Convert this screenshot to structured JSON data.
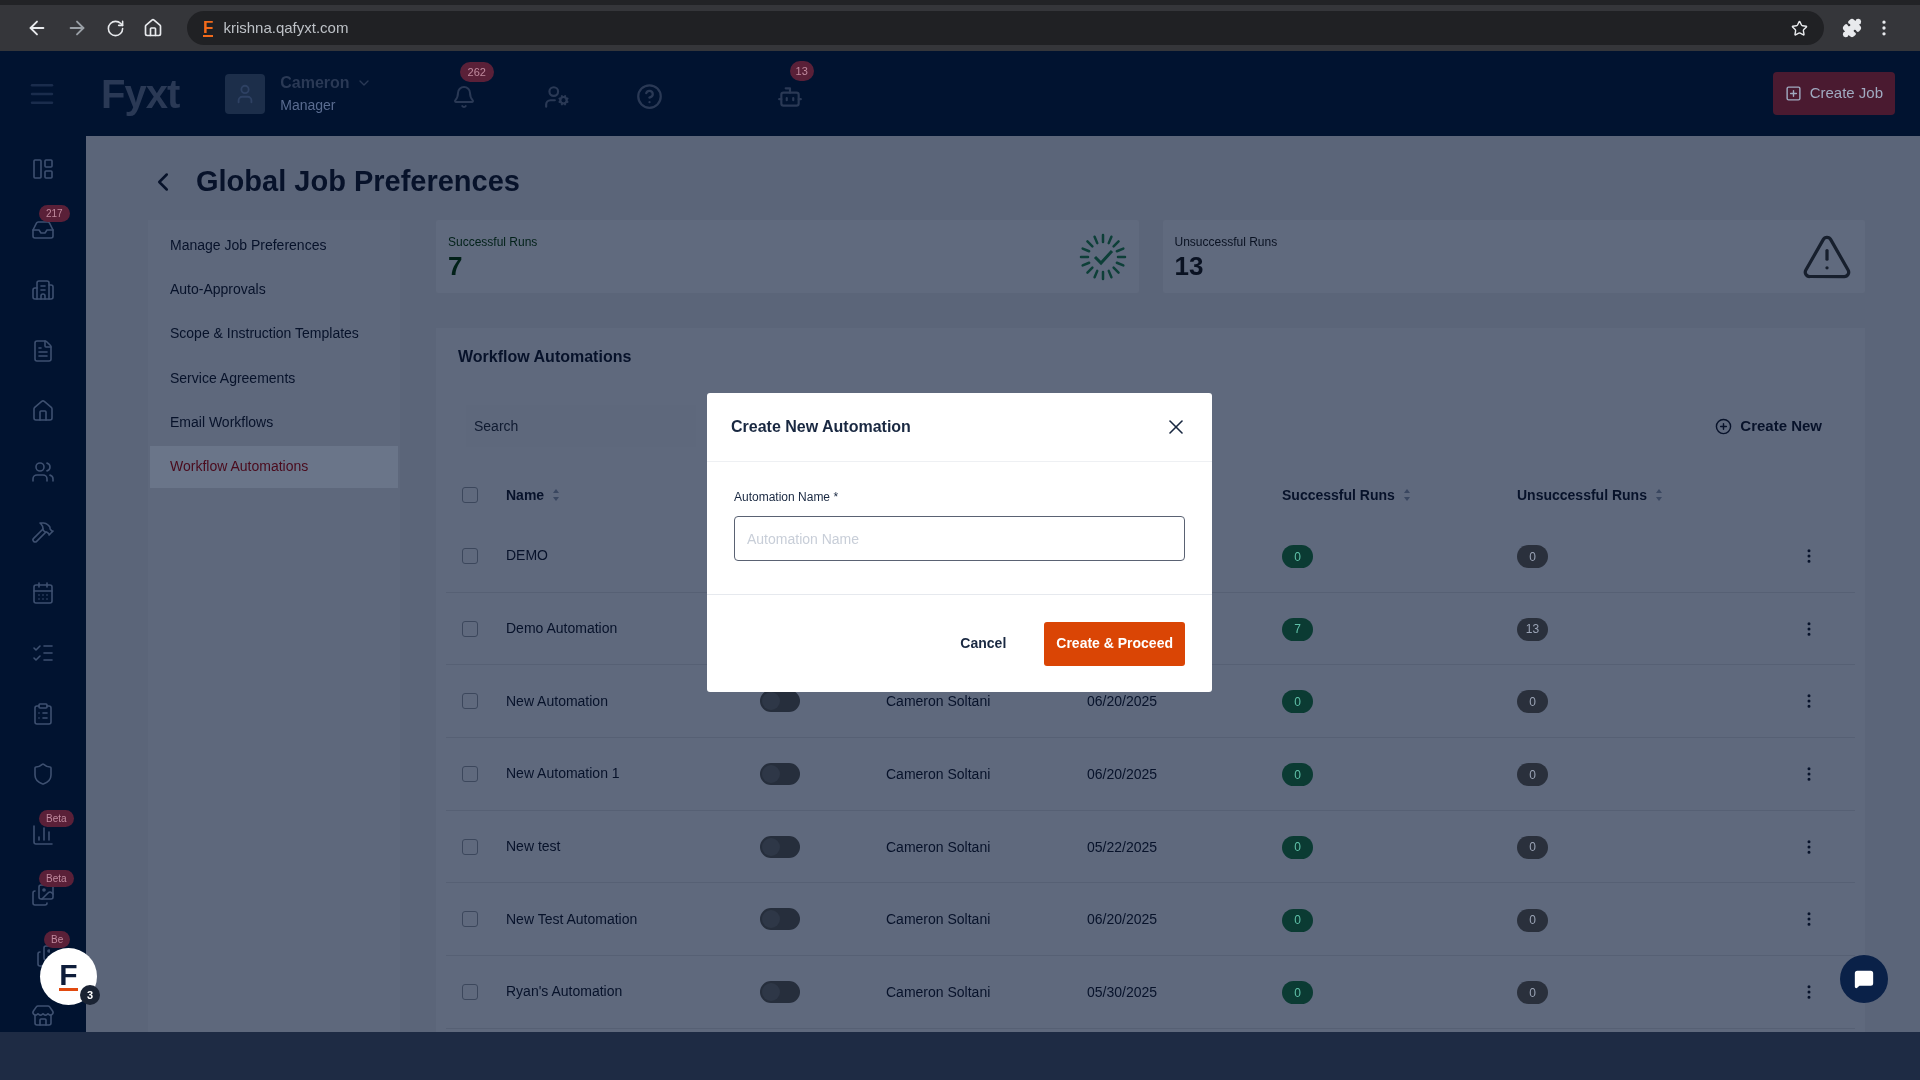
{
  "browser": {
    "favicon_letter": "F",
    "url": "krishna.qafyxt.com"
  },
  "header": {
    "logo": "Fyxt",
    "user": {
      "name": "Cameron",
      "role": "Manager"
    },
    "notifications_badge": "262",
    "robot_badge": "13",
    "create_job_button": "Create Job"
  },
  "sidebar": {
    "items": [
      {
        "selected": false
      },
      {
        "selected": false,
        "badge": "217"
      },
      {
        "selected": false
      },
      {
        "selected": false
      },
      {
        "selected": false
      },
      {
        "selected": false
      },
      {
        "selected": false
      },
      {
        "selected": false
      },
      {
        "selected": false
      },
      {
        "selected": false
      },
      {
        "selected": false
      },
      {
        "selected": false,
        "badge": "Beta"
      },
      {
        "selected": false,
        "badge": "Beta"
      },
      {
        "selected": false,
        "badge": "Be"
      },
      {
        "selected": false
      }
    ]
  },
  "page": {
    "title": "Global Job Preferences"
  },
  "nav": {
    "items": [
      {
        "label": "Manage Job Preferences",
        "selected": false
      },
      {
        "label": "Auto-Approvals",
        "selected": false
      },
      {
        "label": "Scope & Instruction Templates",
        "selected": false
      },
      {
        "label": "Service Agreements",
        "selected": false
      },
      {
        "label": "Email Workflows",
        "selected": false
      },
      {
        "label": "Workflow Automations",
        "selected": true
      }
    ]
  },
  "stats": [
    {
      "label": "Successful Runs",
      "value": "7",
      "kind": "success"
    },
    {
      "label": "Unsuccessful Runs",
      "value": "13",
      "kind": "failure"
    }
  ],
  "workflow": {
    "title": "Workflow Automations",
    "search": {
      "placeholder": "Search"
    },
    "create_button": "Create New",
    "select_all_checked": false,
    "columns": [
      "Name",
      "Successful Runs",
      "Unsuccessful Runs"
    ],
    "rows": [
      {
        "checked": false,
        "name": "DEMO",
        "successful": "0",
        "unsuccessful": "0"
      },
      {
        "checked": false,
        "name": "Demo Automation",
        "successful": "7",
        "unsuccessful": "13"
      },
      {
        "checked": false,
        "name": "New Automation",
        "enabled": false,
        "created_by": "Cameron Soltani",
        "date": "06/20/2025",
        "successful": "0",
        "unsuccessful": "0"
      },
      {
        "checked": false,
        "name": "New Automation 1",
        "enabled": false,
        "created_by": "Cameron Soltani",
        "date": "06/20/2025",
        "successful": "0",
        "unsuccessful": "0"
      },
      {
        "checked": false,
        "name": "New test",
        "enabled": false,
        "created_by": "Cameron Soltani",
        "date": "05/22/2025",
        "successful": "0",
        "unsuccessful": "0"
      },
      {
        "checked": false,
        "name": "New Test Automation",
        "enabled": false,
        "created_by": "Cameron Soltani",
        "date": "06/20/2025",
        "successful": "0",
        "unsuccessful": "0"
      },
      {
        "checked": false,
        "name": "Ryan's Automation",
        "enabled": false,
        "created_by": "Cameron Soltani",
        "date": "05/30/2025",
        "successful": "0",
        "unsuccessful": "0"
      }
    ]
  },
  "modal": {
    "title": "Create New Automation",
    "field": {
      "label": "Automation Name *",
      "placeholder": "Automation Name"
    },
    "buttons": [
      {
        "label": "Cancel",
        "kind": "secondary"
      },
      {
        "label": "Create & Proceed",
        "kind": "primary"
      }
    ]
  },
  "assistant_button": {
    "letter": "F",
    "badge": "3"
  }
}
